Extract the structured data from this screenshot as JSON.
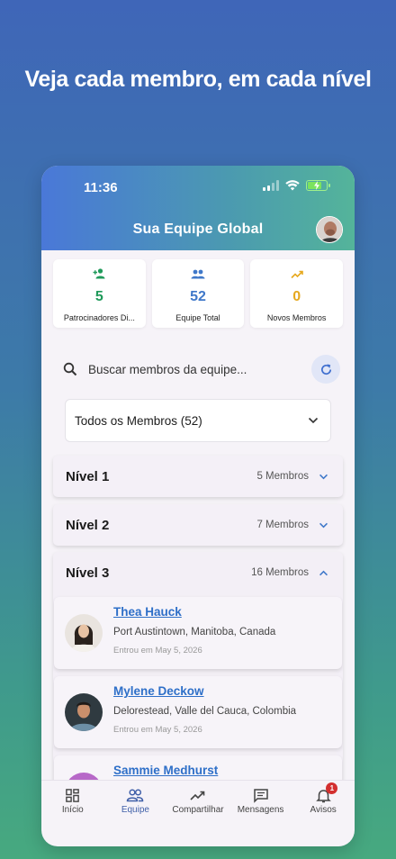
{
  "headline": "Veja cada membro, em cada nível",
  "status_bar": {
    "time": "11:36"
  },
  "app_bar": {
    "title": "Sua Equipe Global"
  },
  "stats": [
    {
      "icon": "person-add-icon",
      "value": "5",
      "label": "Patrocinadores Di...",
      "color": "#1f9a5a"
    },
    {
      "icon": "group-icon",
      "value": "52",
      "label": "Equipe Total",
      "color": "#3f78c9"
    },
    {
      "icon": "trending-up-icon",
      "value": "0",
      "label": "Novos Membros",
      "color": "#e6a81e"
    }
  ],
  "search": {
    "placeholder": "Buscar membros da equipe..."
  },
  "filter": {
    "selected": "Todos os Membros (52)"
  },
  "levels": [
    {
      "name": "Nível 1",
      "count": "5 Membros",
      "expanded": false
    },
    {
      "name": "Nível 2",
      "count": "7 Membros",
      "expanded": false
    },
    {
      "name": "Nível 3",
      "count": "16 Membros",
      "expanded": true
    }
  ],
  "members": [
    {
      "name": "Thea Hauck",
      "location": "Port Austintown, Manitoba, Canada",
      "joined": "Entrou em May 5, 2026"
    },
    {
      "name": "Mylene Deckow",
      "location": "Delorestead, Valle del Cauca, Colombia",
      "joined": "Entrou em May 5, 2026"
    },
    {
      "name": "Sammie Medhurst",
      "location": "",
      "joined": ""
    }
  ],
  "nav": [
    {
      "label": "Início",
      "icon": "dashboard-icon"
    },
    {
      "label": "Equipe",
      "icon": "team-icon"
    },
    {
      "label": "Compartilhar",
      "icon": "share-trend-icon"
    },
    {
      "label": "Mensagens",
      "icon": "message-icon"
    },
    {
      "label": "Avisos",
      "icon": "bell-icon",
      "badge": "1"
    }
  ],
  "colors": {
    "accent": "#3f78c9",
    "link": "#2e6fc8",
    "badge": "#d32f2f"
  }
}
